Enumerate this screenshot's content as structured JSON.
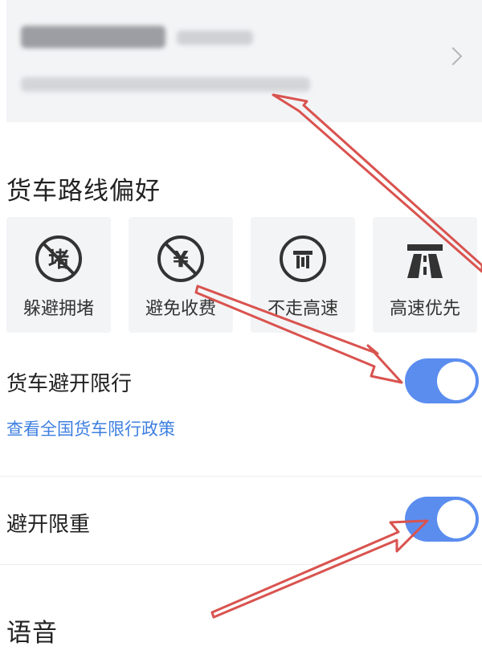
{
  "route_preferences": {
    "title": "货车路线偏好",
    "options": [
      {
        "label": "躲避拥堵",
        "icon": "avoid-congestion-icon"
      },
      {
        "label": "避免收费",
        "icon": "avoid-toll-icon"
      },
      {
        "label": "不走高速",
        "icon": "no-highway-icon"
      },
      {
        "label": "高速优先",
        "icon": "highway-icon"
      }
    ]
  },
  "settings": {
    "avoid_restrictions": {
      "label": "货车避开限行",
      "enabled": true
    },
    "policy_link": "查看全国货车限行政策",
    "avoid_weight_limit": {
      "label": "避开限重",
      "enabled": true
    }
  },
  "voice": {
    "title": "语音"
  },
  "colors": {
    "toggle_on": "#5b8def",
    "link": "#3d7fe0",
    "annotation_arrow": "#d9534f"
  }
}
